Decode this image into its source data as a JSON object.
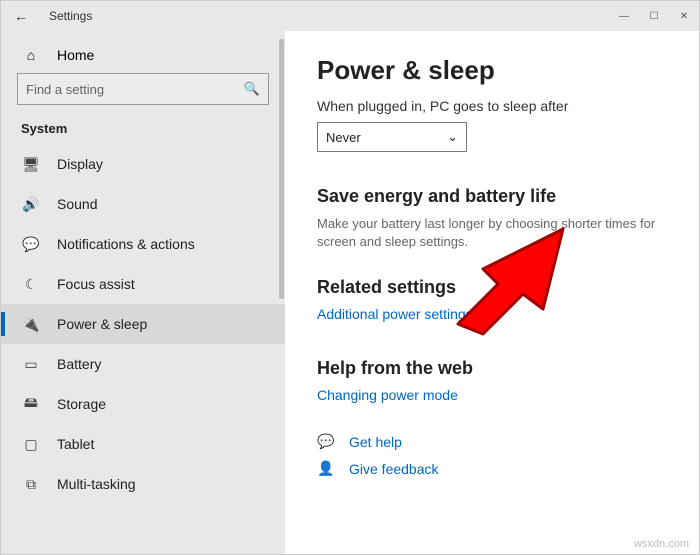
{
  "window": {
    "title": "Settings",
    "buttons": {
      "min": "—",
      "max": "☐",
      "close": "✕"
    },
    "back": "←"
  },
  "sidebar": {
    "home": "Home",
    "search_placeholder": "Find a setting",
    "group": "System",
    "items": [
      {
        "icon": "🖥",
        "label": "Display"
      },
      {
        "icon": "🔊",
        "label": "Sound"
      },
      {
        "icon": "💬",
        "label": "Notifications & actions"
      },
      {
        "icon": "☾",
        "label": "Focus assist"
      },
      {
        "icon": "🔌",
        "label": "Power & sleep",
        "selected": true
      },
      {
        "icon": "▭",
        "label": "Battery"
      },
      {
        "icon": "🖴",
        "label": "Storage"
      },
      {
        "icon": "▢",
        "label": "Tablet"
      },
      {
        "icon": "⧉",
        "label": "Multi-tasking"
      }
    ]
  },
  "content": {
    "title": "Power & sleep",
    "plugged_label": "When plugged in, PC goes to sleep after",
    "plugged_value": "Never",
    "save_heading": "Save energy and battery life",
    "save_desc": "Make your battery last longer by choosing shorter times for screen and sleep settings.",
    "related_heading": "Related settings",
    "related_link": "Additional power settings",
    "help_heading": "Help from the web",
    "help_link": "Changing power mode",
    "get_help": "Get help",
    "feedback": "Give feedback"
  },
  "watermark": "wsxdn.com"
}
